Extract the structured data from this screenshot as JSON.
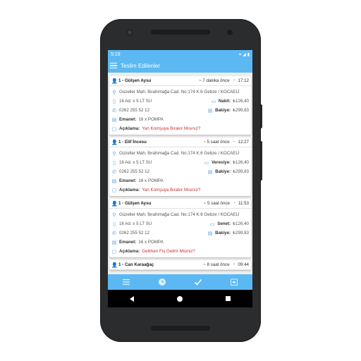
{
  "status": {
    "time": "5:19"
  },
  "appbar": {
    "title": "Teslim Edilenler"
  },
  "cards": [
    {
      "head": {
        "name": "1 - Gülşen Aysu",
        "ago": "~ 7 dakika önce",
        "time": "17:12"
      },
      "address": "Güzeller Mah. İbrahimağa Cad. No:174 K:6 Gebze / KOCAELİ",
      "product": "16 Ad. x 5 LT SU",
      "payment_label": "Nakit:",
      "payment_value": "₺126,40",
      "phone": "0262 255 52 12",
      "balance_label": "Bakiye:",
      "balance_value": "₺299,83",
      "emanet_label": "Emanet:",
      "emanet_value": "16 x POMPA",
      "note_label": "Açıklama:",
      "note_value": "Yan Komşuya Bırakır Mısınız?"
    },
    {
      "head": {
        "name": "1 - Elif İncesu",
        "ago": "~ 5 saat önce",
        "time": "12:27"
      },
      "address": "Güzeller Mah. İbrahimağa Cad. No:174 K:6 Gebze / KOCAELİ",
      "product": "16 Ad. x 5 LT SU",
      "payment_label": "Veresiye:",
      "payment_value": "₺126,40",
      "phone": "0262 255 52 12",
      "balance_label": "Bakiye:",
      "balance_value": "₺299,83",
      "emanet_label": "Emanet:",
      "emanet_value": "16 x POMPA",
      "note_label": "Açıklama:",
      "note_value": "Yan Komşuya Bırakır Mısınız?"
    },
    {
      "head": {
        "name": "1 - Gülşen Aysu",
        "ago": "~ 5 saat önce",
        "time": "11:53"
      },
      "address": "Güzeller Mah. İbrahimağa Cad. No:174 K:6 Gebze / KOCAELİ",
      "product": "16 Ad. x 5 LT SU",
      "payment_label": "Senet:",
      "payment_value": "₺126,40",
      "phone": "0262 255 52 12",
      "balance_label": "Bakiye:",
      "balance_value": "₺299,83",
      "emanet_label": "Emanet:",
      "emanet_value": "16 x POMPA",
      "note_label": "Açıklama:",
      "note_value": "Gelirken Fiş Getirir Misiniz?"
    },
    {
      "head": {
        "name": "1 - Can Karaağaç",
        "ago": "~ 8 saat önce",
        "time": "09:44"
      }
    }
  ],
  "colors": {
    "accent": "#5cb8f3",
    "note": "#c8302f",
    "icon": "#5b9fd6"
  },
  "icons": [
    "menu-icon",
    "user-icon",
    "clock-icon",
    "location-icon",
    "bottle-icon",
    "wallet-icon",
    "phone-icon",
    "briefcase-icon",
    "chat-icon",
    "list-icon",
    "history-icon",
    "check-icon",
    "archive-icon"
  ]
}
